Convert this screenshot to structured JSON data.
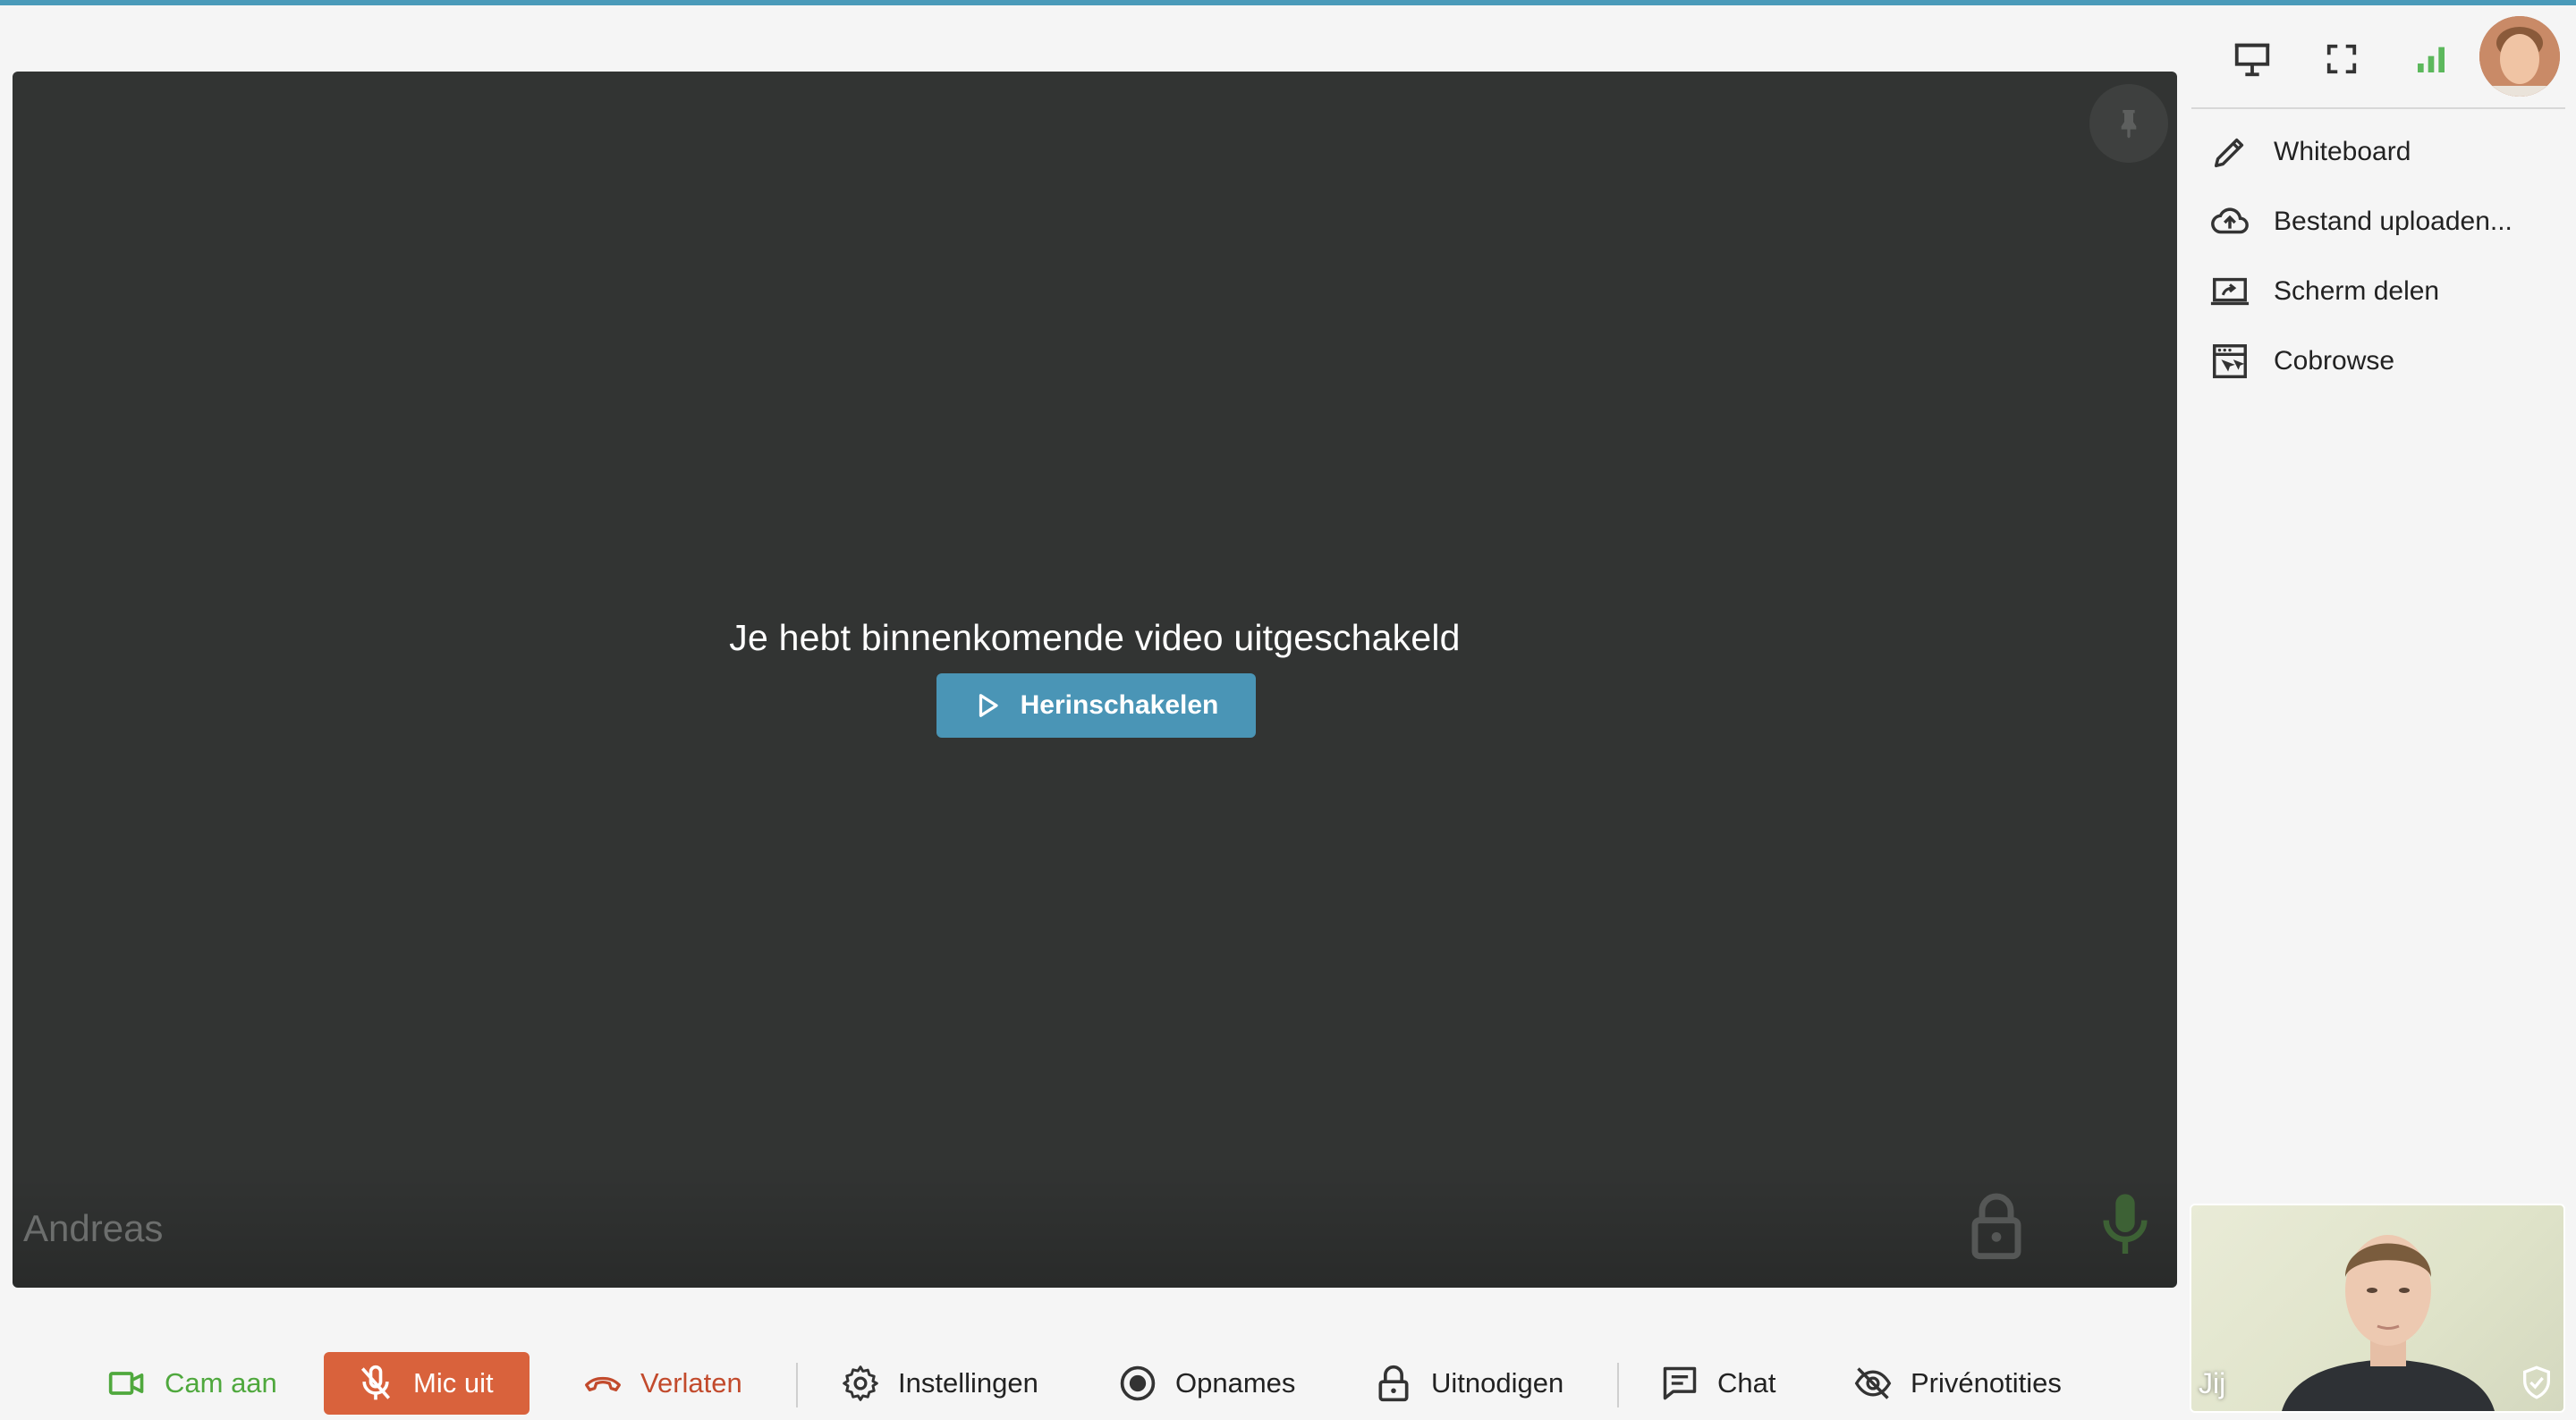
{
  "main_video": {
    "message": "Je hebt binnenkomende video uitgeschakeld",
    "resume_label": "Herinschakelen",
    "participant_name": "Andreas"
  },
  "side_menu": {
    "items": [
      {
        "label": "Whiteboard",
        "icon": "pencil-icon"
      },
      {
        "label": "Bestand uploaden...",
        "icon": "cloud-upload-icon"
      },
      {
        "label": "Scherm delen",
        "icon": "screen-share-icon"
      },
      {
        "label": "Cobrowse",
        "icon": "cobrowse-icon"
      }
    ]
  },
  "self_view": {
    "label": "Jij"
  },
  "bottom_bar": {
    "cam_label": "Cam aan",
    "mic_label": "Mic uit",
    "leave_label": "Verlaten",
    "settings_label": "Instellingen",
    "recordings_label": "Opnames",
    "invite_label": "Uitnodigen",
    "chat_label": "Chat",
    "private_notes_label": "Privénotities"
  },
  "colors": {
    "accent": "#4a9ab9",
    "resume_button": "#4a95b6",
    "mic_off": "#d9623c",
    "cam_on": "#4fa83d",
    "leave": "#c24a2c",
    "signal": "#5cb85c",
    "video_bg": "#323433"
  }
}
